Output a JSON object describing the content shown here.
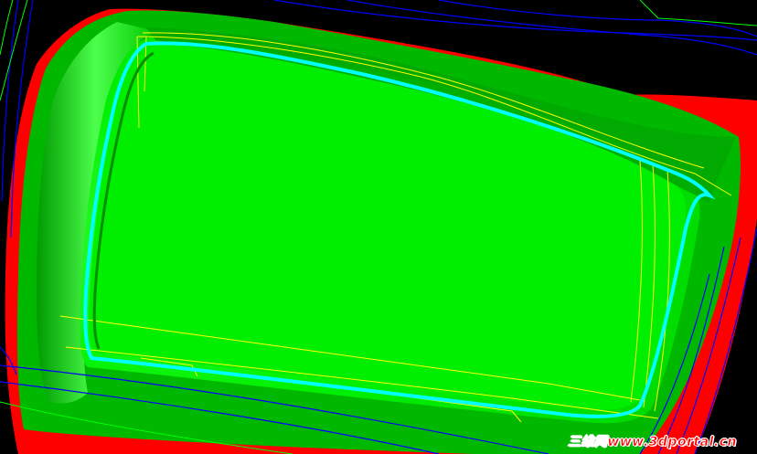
{
  "viewport": {
    "background": "#000000",
    "model_color": "#00e600",
    "highlight_color": "#66ff66",
    "shadow_color": "#00a000",
    "flange_color": "#ff0000",
    "outline_color": "#00ffff",
    "wire_colors": [
      "#0000ff",
      "#ffff00",
      "#00ff00"
    ]
  },
  "watermark": {
    "text": "三维网www.3dportal.cn",
    "color": "#ff0000"
  }
}
